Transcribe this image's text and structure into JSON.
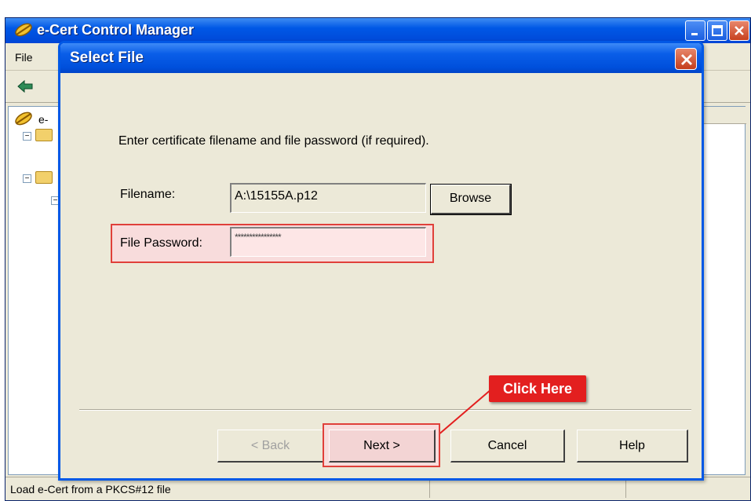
{
  "main_window": {
    "title": "e-Cert Control Manager",
    "menu": {
      "file": "File"
    },
    "tree": {
      "root_label": "e-"
    },
    "status_text": "Load e-Cert from a PKCS#12 file"
  },
  "dialog": {
    "title": "Select File",
    "instruction": "Enter certificate filename and file password (if required).",
    "filename_label": "Filename:",
    "filename_value": "A:\\15155A.p12",
    "browse_label": "Browse",
    "password_label": "File Password:",
    "password_value": "****************",
    "buttons": {
      "back": "< Back",
      "next": "Next >",
      "cancel": "Cancel",
      "help": "Help"
    }
  },
  "annotation": {
    "callout_text": "Click Here",
    "highlight_color": "#e0403a"
  },
  "colors": {
    "titlebar": "#0058e6",
    "window_bg": "#ece9d8",
    "close_button": "#c7411f"
  },
  "icons": [
    "app-icon",
    "minimize-icon",
    "maximize-icon",
    "close-icon",
    "back-arrow-icon",
    "folder-icon"
  ]
}
